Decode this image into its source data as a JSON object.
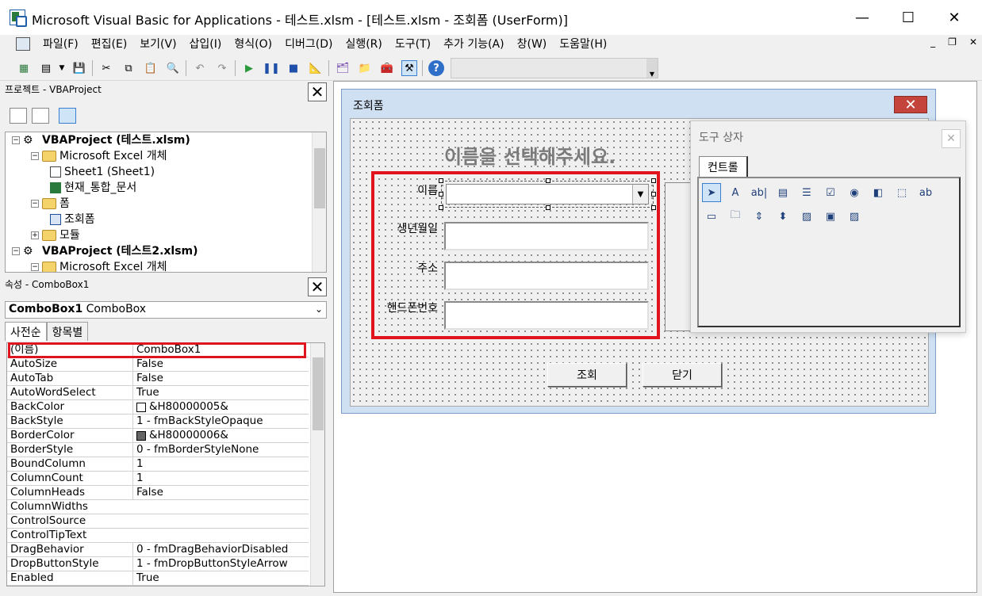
{
  "window": {
    "title": "Microsoft Visual Basic for Applications - 테스트.xlsm - [테스트.xlsm - 조회폼 (UserForm)]",
    "minimize": "—",
    "maximize": "☐",
    "close": "✕"
  },
  "menu": {
    "items": [
      "파일(F)",
      "편집(E)",
      "보기(V)",
      "삽입(I)",
      "형식(O)",
      "디버그(D)",
      "실행(R)",
      "도구(T)",
      "추가 기능(A)",
      "창(W)",
      "도움말(H)"
    ],
    "mdi_minimize": "_",
    "mdi_restore": "❐",
    "mdi_close": "✕"
  },
  "toolbar": {
    "icons": [
      "excel-icon",
      "insert-form-icon",
      "save-icon",
      "cut-icon",
      "copy-icon",
      "paste-icon",
      "find-icon",
      "undo-icon",
      "redo-icon",
      "run-icon",
      "break-icon",
      "reset-icon",
      "design-mode-icon",
      "project-explorer-icon",
      "properties-icon",
      "object-browser-icon",
      "toolbox-icon",
      "help-icon"
    ]
  },
  "project": {
    "title": "프로젝트 - VBAProject",
    "close": "✕",
    "tree": [
      {
        "label": "VBAProject (테스트.xlsm)",
        "level": 0,
        "bold": true,
        "icon": "vba"
      },
      {
        "label": "Microsoft Excel 개체",
        "level": 1,
        "icon": "folder"
      },
      {
        "label": "Sheet1 (Sheet1)",
        "level": 2,
        "icon": "sheet"
      },
      {
        "label": "현재_통합_문서",
        "level": 2,
        "icon": "workbook"
      },
      {
        "label": "폼",
        "level": 1,
        "icon": "folder"
      },
      {
        "label": "조회폼",
        "level": 2,
        "icon": "form"
      },
      {
        "label": "모듈",
        "level": 1,
        "icon": "folder"
      },
      {
        "label": "VBAProject (테스트2.xlsm)",
        "level": 0,
        "bold": true,
        "icon": "vba"
      },
      {
        "label": "Microsoft Excel 개체",
        "level": 1,
        "icon": "folder"
      }
    ]
  },
  "properties": {
    "title": "속성 - ComboBox1",
    "close": "✕",
    "object_name": "ComboBox1",
    "object_type": "ComboBox",
    "tabs": [
      "사전순",
      "항목별"
    ],
    "rows": [
      {
        "name": "(이름)",
        "value": "ComboBox1"
      },
      {
        "name": "AutoSize",
        "value": "False"
      },
      {
        "name": "AutoTab",
        "value": "False"
      },
      {
        "name": "AutoWordSelect",
        "value": "True"
      },
      {
        "name": "BackColor",
        "value": "&H80000005&",
        "swatch": "#ffffff"
      },
      {
        "name": "BackStyle",
        "value": "1 - fmBackStyleOpaque"
      },
      {
        "name": "BorderColor",
        "value": "&H80000006&",
        "swatch": "#646464"
      },
      {
        "name": "BorderStyle",
        "value": "0 - fmBorderStyleNone"
      },
      {
        "name": "BoundColumn",
        "value": "1"
      },
      {
        "name": "ColumnCount",
        "value": "1"
      },
      {
        "name": "ColumnHeads",
        "value": "False"
      },
      {
        "name": "ColumnWidths",
        "value": ""
      },
      {
        "name": "ControlSource",
        "value": ""
      },
      {
        "name": "ControlTipText",
        "value": ""
      },
      {
        "name": "DragBehavior",
        "value": "0 - fmDragBehaviorDisabled"
      },
      {
        "name": "DropButtonStyle",
        "value": "1 - fmDropButtonStyleArrow"
      },
      {
        "name": "Enabled",
        "value": "True"
      }
    ]
  },
  "userform": {
    "title": "조회폼",
    "close": "✕",
    "heading": "이름을 선택해주세요.",
    "labels": {
      "name": "이름",
      "birth": "생년월일",
      "address": "주소",
      "phone": "핸드폰번호"
    },
    "combo_arrow": "▼",
    "buttons": {
      "search": "조회",
      "close": "닫기"
    }
  },
  "toolbox": {
    "title": "도구 상자",
    "close": "✕",
    "tab": "컨트롤",
    "tools": [
      {
        "name": "select-objects-icon",
        "glyph": "➤"
      },
      {
        "name": "label-icon",
        "glyph": "A"
      },
      {
        "name": "textbox-icon",
        "glyph": "ab|"
      },
      {
        "name": "combobox-icon",
        "glyph": "▤"
      },
      {
        "name": "listbox-icon",
        "glyph": "☰"
      },
      {
        "name": "checkbox-icon",
        "glyph": "☑"
      },
      {
        "name": "optionbutton-icon",
        "glyph": "◉"
      },
      {
        "name": "togglebutton-icon",
        "glyph": "◧"
      },
      {
        "name": "frame-icon",
        "glyph": "⬚"
      },
      {
        "name": "commandbutton-icon",
        "glyph": "ab"
      },
      {
        "name": "tabstrip-icon",
        "glyph": "▭"
      },
      {
        "name": "multipage-icon",
        "glyph": "🗀"
      },
      {
        "name": "scrollbar-icon",
        "glyph": "⇕"
      },
      {
        "name": "spinbutton-icon",
        "glyph": "⬍"
      },
      {
        "name": "image-icon",
        "glyph": "▨"
      },
      {
        "name": "refedit-icon",
        "glyph": "▣"
      },
      {
        "name": "image2-icon",
        "glyph": "▨"
      }
    ]
  },
  "colors": {
    "highlight_red": "#e0141e",
    "form_caption": "#cfe0f3"
  }
}
